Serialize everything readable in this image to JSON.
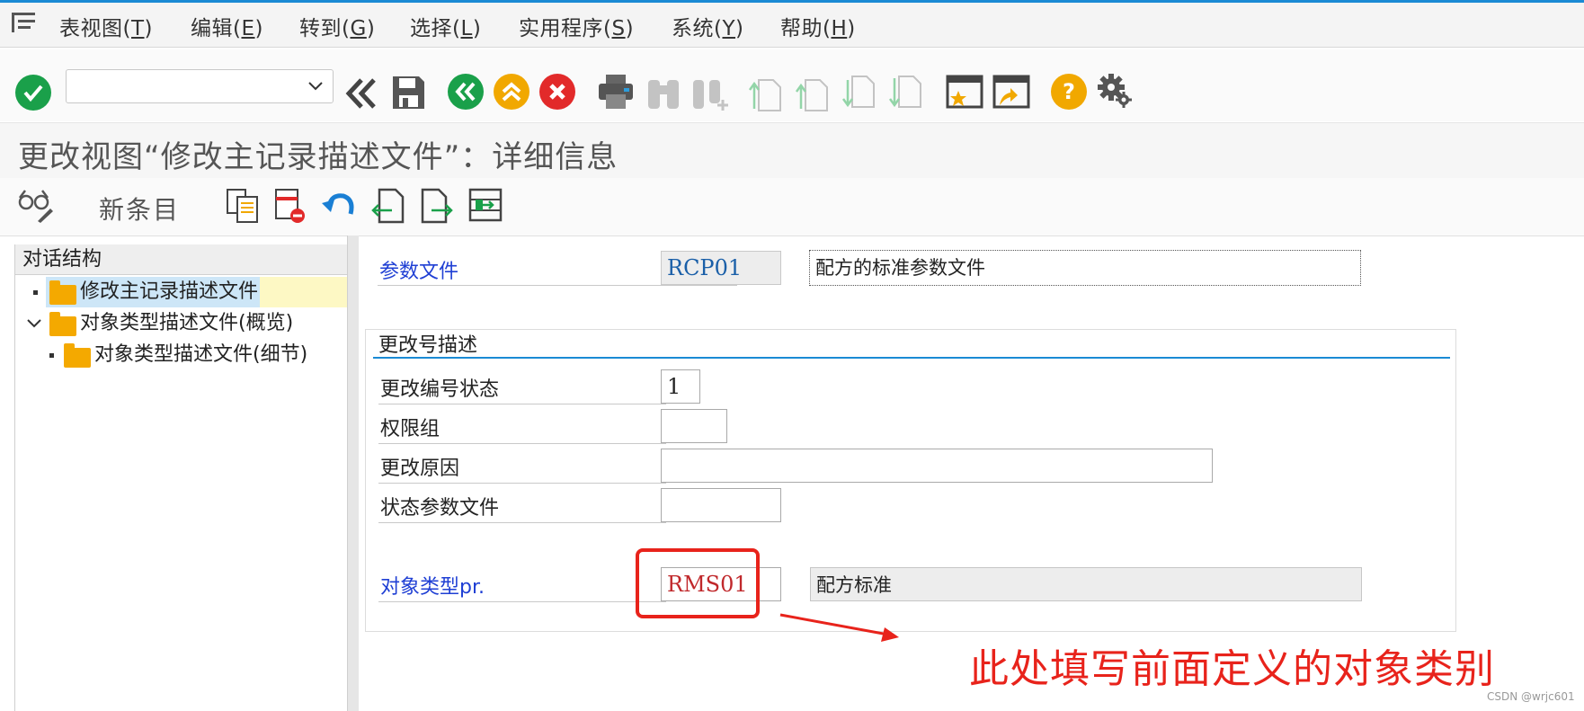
{
  "menu": {
    "items": [
      {
        "text": "表视图(",
        "key": "T",
        "tail": ")"
      },
      {
        "text": "编辑(",
        "key": "E",
        "tail": ")"
      },
      {
        "text": "转到(",
        "key": "G",
        "tail": ")"
      },
      {
        "text": "选择(",
        "key": "L",
        "tail": ")"
      },
      {
        "text": "实用程序(",
        "key": "S",
        "tail": ")"
      },
      {
        "text": "系统(",
        "key": "Y",
        "tail": ")"
      },
      {
        "text": "帮助(",
        "key": "H",
        "tail": ")"
      }
    ]
  },
  "toolbar": {
    "command_field_value": "",
    "colors": {
      "green": "#1aa04a",
      "amber": "#f1a800",
      "red": "#e22a2a",
      "grey": "#606060",
      "light_grey": "#c3c3c3"
    }
  },
  "page_title": "更改视图“修改主记录描述文件”：详细信息",
  "app_toolbar": {
    "new_entries": "新条目"
  },
  "tree": {
    "header": "对话结构",
    "items": [
      {
        "label": "修改主记录描述文件",
        "selected": true
      },
      {
        "label": "对象类型描述文件(概览)",
        "expanded": true
      },
      {
        "label": "对象类型描述文件(细节)"
      }
    ]
  },
  "form": {
    "param_file": {
      "label": "参数文件",
      "value": "RCP01",
      "description": "配方的标准参数文件"
    },
    "group_title": "更改号描述",
    "change_status": {
      "label": "更改编号状态",
      "value": "1"
    },
    "auth_group": {
      "label": "权限组",
      "value": ""
    },
    "change_reason": {
      "label": "更改原因",
      "value": ""
    },
    "status_profile": {
      "label": "状态参数文件",
      "value": ""
    },
    "object_type": {
      "label": "对象类型pr.",
      "value": "RMS01",
      "description": "配方标准"
    }
  },
  "annotation": {
    "text": "此处填写前面定义的对象类别",
    "color": "#e8231b"
  },
  "watermark": "CSDN @wrjc601"
}
